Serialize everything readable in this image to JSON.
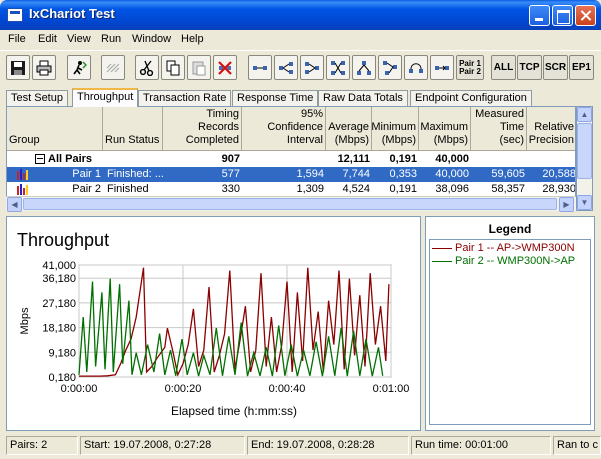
{
  "window": {
    "title": "IxChariot Test"
  },
  "menu": {
    "items": [
      "File",
      "Edit",
      "View",
      "Run",
      "Window",
      "Help"
    ]
  },
  "toolbar": {
    "pair_label_top": "Pair 1",
    "pair_label_bottom": "Pair 2",
    "text_buttons": [
      "ALL",
      "TCP",
      "SCR",
      "EP1"
    ]
  },
  "tabs": [
    "Test Setup",
    "Throughput",
    "Transaction Rate",
    "Response Time",
    "Raw Data Totals",
    "Endpoint Configuration"
  ],
  "active_tab": "Throughput",
  "grid": {
    "headers": {
      "group": "Group",
      "run_status": "Run Status",
      "timing_records": "Timing Records Completed",
      "confidence": "95% Confidence Interval",
      "average": "Average (Mbps)",
      "minimum": "Minimum (Mbps)",
      "maximum": "Maximum (Mbps)",
      "measured_time": "Measured Time (sec)",
      "relative_precision": "Relative Precision"
    },
    "all_pairs": {
      "group": "All Pairs",
      "timing_records": "907",
      "average": "12,111",
      "minimum": "0,191",
      "maximum": "40,000"
    },
    "rows": [
      {
        "group": "Pair 1",
        "run_status": "Finished: ...",
        "timing_records": "577",
        "confidence": "1,594",
        "average": "7,744",
        "minimum": "0,353",
        "maximum": "40,000",
        "measured_time": "59,605",
        "relative_precision": "20,588"
      },
      {
        "group": "Pair 2",
        "run_status": "Finished",
        "timing_records": "330",
        "confidence": "1,309",
        "average": "4,524",
        "minimum": "0,191",
        "maximum": "38,096",
        "measured_time": "58,357",
        "relative_precision": "28,930"
      }
    ]
  },
  "chart_data": {
    "type": "line",
    "title": "Throughput",
    "xlabel": "Elapsed time (h:mm:ss)",
    "ylabel": "Mbps",
    "x_ticks": [
      "0:00:00",
      "0:00:20",
      "0:00:40",
      "0:01:00"
    ],
    "y_ticks": [
      "0,180",
      "9,180",
      "18,180",
      "27,180",
      "36,180",
      "41,000"
    ],
    "y_tick_values": [
      0.18,
      9.18,
      18.18,
      27.18,
      36.18,
      41.0
    ],
    "xlim": [
      0,
      60
    ],
    "ylim": [
      0.18,
      41.0
    ],
    "grid": true,
    "series": [
      {
        "name": "Pair 1 -- AP->WMP300N",
        "color": "#8b0000",
        "x": [
          0,
          2,
          4,
          5.5,
          7,
          8,
          9,
          10,
          11,
          12.4,
          13,
          14,
          15,
          16.5,
          17,
          18,
          19,
          20,
          21,
          22,
          23,
          24,
          25,
          26,
          27,
          28,
          29,
          30,
          31,
          32,
          33,
          34,
          35,
          36,
          37,
          38,
          39,
          40,
          41,
          42,
          43,
          44,
          45,
          46,
          47,
          48,
          49,
          50,
          51,
          52,
          53,
          54,
          55,
          56,
          57,
          58,
          59,
          59.6
        ],
        "y": [
          0.5,
          0.5,
          0.5,
          0.6,
          1.0,
          5.0,
          10.0,
          14.0,
          22.0,
          40.0,
          2.0,
          4.0,
          7.0,
          11.0,
          18.0,
          10.0,
          1.0,
          5.0,
          12.0,
          25.0,
          4.0,
          10.0,
          33.0,
          2.0,
          8.0,
          16.0,
          39.0,
          3.0,
          14.0,
          26.0,
          2.0,
          10.0,
          38.0,
          4.0,
          22.0,
          2.0,
          12.0,
          35.0,
          2.0,
          31.0,
          6.0,
          40.0,
          10.0,
          24.0,
          2.0,
          28.0,
          12.0,
          39.0,
          3.0,
          36.0,
          8.0,
          30.0,
          4.0,
          38.0,
          12.0,
          26.0,
          6.0,
          34.0
        ]
      },
      {
        "name": "Pair 2 -- WMP300N->AP",
        "color": "#007000",
        "x": [
          0,
          0.8,
          1.5,
          2.6,
          3.2,
          4.4,
          5,
          6,
          6.6,
          7.8,
          8.4,
          9.6,
          10.2,
          11,
          12,
          13.2,
          14.4,
          15.5,
          16.5,
          17.6,
          18.6,
          19.8,
          20.8,
          22,
          23,
          24,
          25.2,
          26.4,
          27.6,
          28.8,
          30,
          31.2,
          32.4,
          33.6,
          34.8,
          36,
          37.2,
          38.4,
          39.6,
          40.8,
          42,
          43.2,
          44.4,
          45.6,
          46.8,
          48,
          49.2,
          50.4,
          51.6,
          52.8,
          54,
          55.2,
          56.4,
          57.6,
          58.4
        ],
        "y": [
          1.0,
          22.0,
          2.0,
          35.0,
          4.0,
          31.0,
          3.0,
          36.0,
          2.0,
          34.0,
          5.0,
          28.0,
          1.0,
          9.0,
          1.0,
          12.0,
          2.0,
          16.0,
          1.0,
          10.0,
          0.6,
          14.0,
          1.0,
          9.0,
          0.5,
          8.0,
          1.0,
          18.0,
          0.6,
          15.0,
          1.0,
          20.0,
          0.5,
          9.0,
          0.6,
          11.0,
          0.5,
          19.0,
          0.6,
          12.0,
          0.5,
          10.0,
          0.6,
          13.0,
          0.5,
          15.0,
          0.6,
          18.0,
          0.5,
          17.0,
          0.6,
          14.0,
          0.5,
          11.0,
          0.6
        ]
      }
    ]
  },
  "legend": {
    "title": "Legend"
  },
  "status": {
    "pairs": "Pairs: 2",
    "start": "Start: 19.07.2008, 0:27:28",
    "end": "End: 19.07.2008, 0:28:28",
    "run_time": "Run time: 00:01:00",
    "ran_to": "Ran to c"
  }
}
